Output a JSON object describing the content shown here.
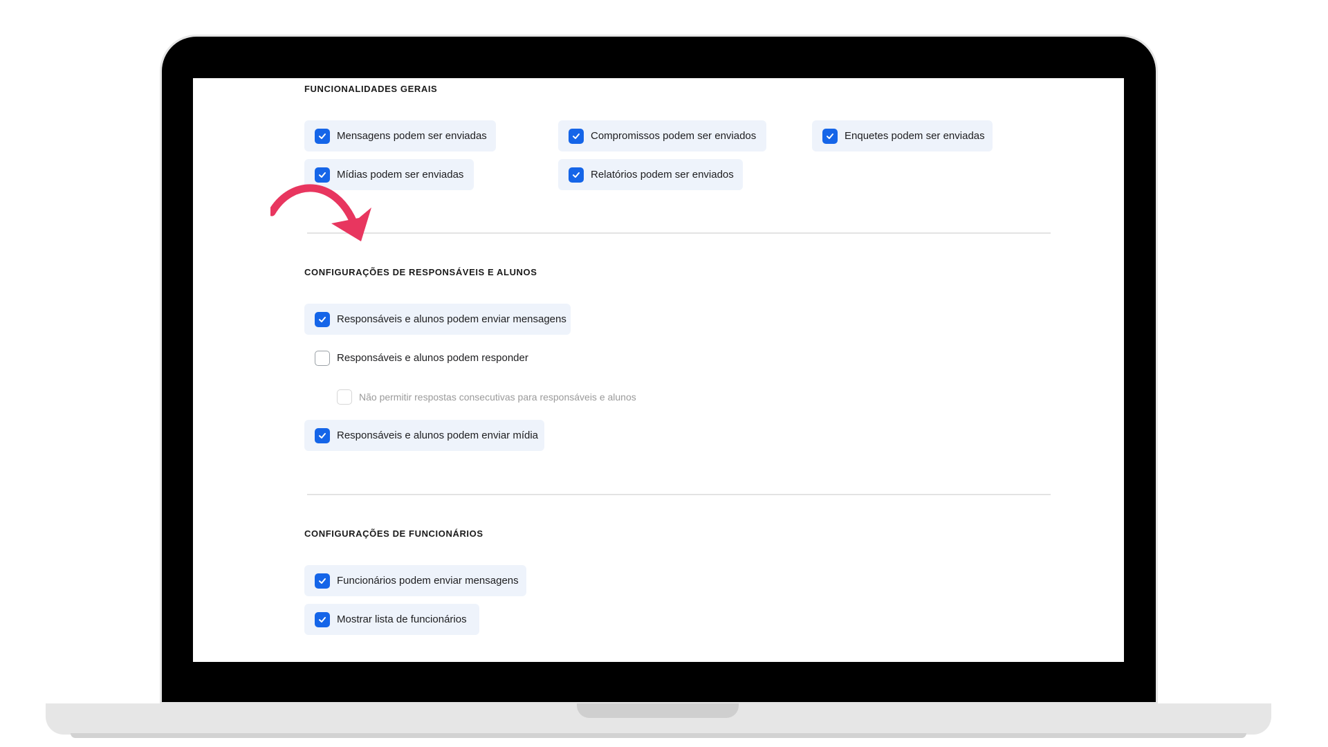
{
  "colors": {
    "accent": "#1565e8",
    "checked_bg": "#eef3fb",
    "annotation_arrow": "#e8365f"
  },
  "sections": [
    {
      "title": "FUNCIONALIDADES GERAIS",
      "options": [
        {
          "label": "Mensagens podem ser enviadas",
          "checked": true
        },
        {
          "label": "Compromissos podem ser enviados",
          "checked": true
        },
        {
          "label": "Enquetes podem ser enviadas",
          "checked": true
        },
        {
          "label": "Mídias podem ser enviadas",
          "checked": true
        },
        {
          "label": "Relatórios podem ser enviados",
          "checked": true
        }
      ]
    },
    {
      "title": "CONFIGURAÇÕES DE RESPONSÁVEIS E ALUNOS",
      "options": [
        {
          "label": "Responsáveis e alunos podem enviar mensagens",
          "checked": true
        },
        {
          "label": "Responsáveis e alunos podem responder",
          "checked": false
        },
        {
          "label": "Não permitir respostas consecutivas para responsáveis e alunos",
          "checked": false,
          "disabled": true
        },
        {
          "label": "Responsáveis e alunos podem enviar mídia",
          "checked": true
        }
      ]
    },
    {
      "title": "CONFIGURAÇÕES DE FUNCIONÁRIOS",
      "options": [
        {
          "label": "Funcionários podem enviar mensagens",
          "checked": true
        },
        {
          "label": "Mostrar lista de funcionários",
          "checked": true
        }
      ]
    }
  ],
  "icons": {
    "checkbox_checked": "checkmark-icon",
    "annotation": "curved-arrow-icon"
  }
}
